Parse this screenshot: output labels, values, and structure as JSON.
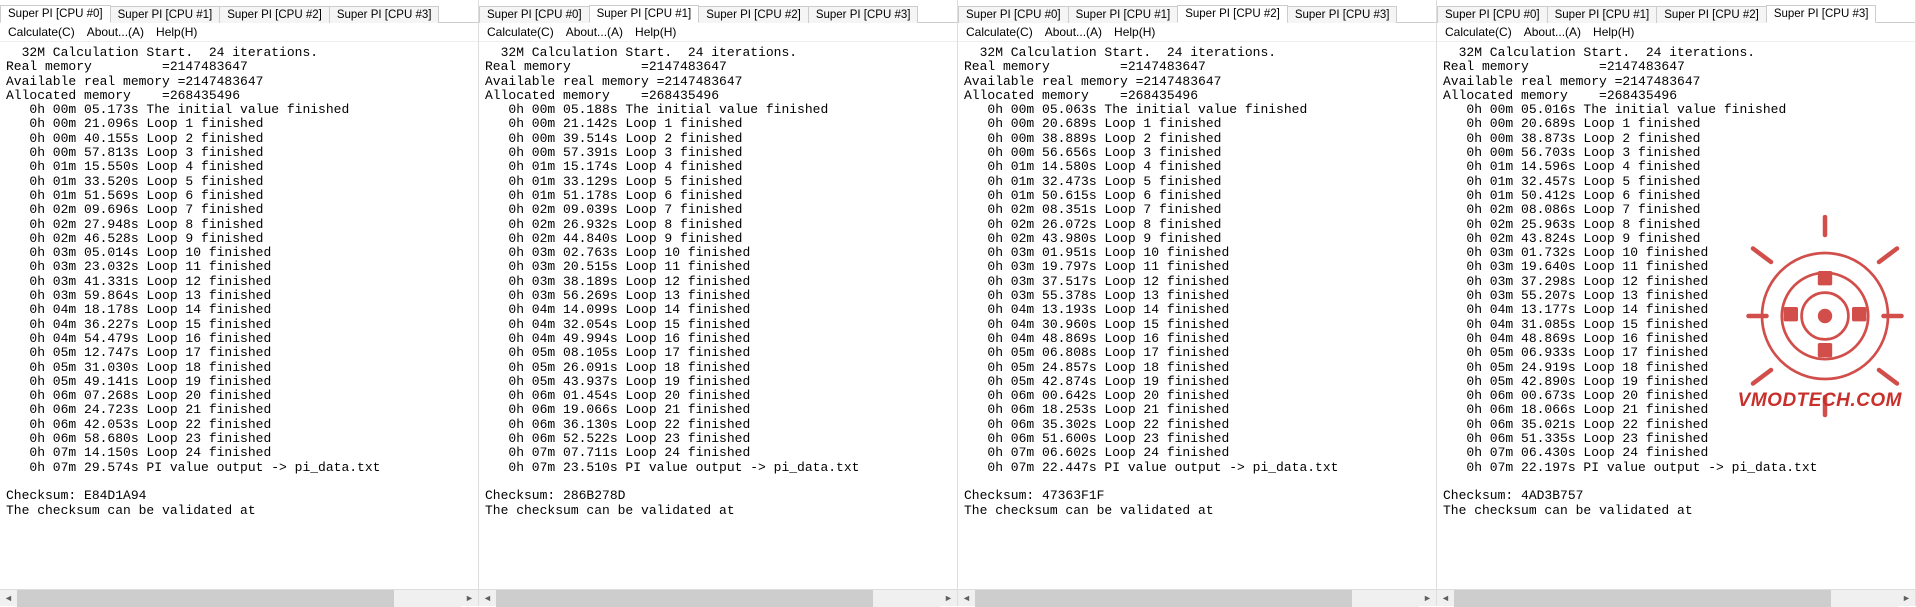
{
  "tabs": [
    "Super PI [CPU #0]",
    "Super PI [CPU #1]",
    "Super PI [CPU #2]",
    "Super PI [CPU #3]"
  ],
  "menu": {
    "calc": "Calculate(C)",
    "about": "About...(A)",
    "help": "Help(H)"
  },
  "header": {
    "start": "  32M Calculation Start.  24 iterations.",
    "real_mem": "Real memory         =2147483647",
    "avail_mem": "Available real memory =2147483647",
    "alloc_mem": "Allocated memory    =268435496"
  },
  "footer": {
    "checksum_label": "Checksum: ",
    "validate": "The checksum can be validated at"
  },
  "watermark_text": "VMODTECH.COM",
  "panes": [
    {
      "active": 0,
      "init": "   0h 00m 05.173s The initial value finished",
      "loops": [
        "   0h 00m 21.096s Loop 1 finished",
        "   0h 00m 40.155s Loop 2 finished",
        "   0h 00m 57.813s Loop 3 finished",
        "   0h 01m 15.550s Loop 4 finished",
        "   0h 01m 33.520s Loop 5 finished",
        "   0h 01m 51.569s Loop 6 finished",
        "   0h 02m 09.696s Loop 7 finished",
        "   0h 02m 27.948s Loop 8 finished",
        "   0h 02m 46.528s Loop 9 finished",
        "   0h 03m 05.014s Loop 10 finished",
        "   0h 03m 23.032s Loop 11 finished",
        "   0h 03m 41.331s Loop 12 finished",
        "   0h 03m 59.864s Loop 13 finished",
        "   0h 04m 18.178s Loop 14 finished",
        "   0h 04m 36.227s Loop 15 finished",
        "   0h 04m 54.479s Loop 16 finished",
        "   0h 05m 12.747s Loop 17 finished",
        "   0h 05m 31.030s Loop 18 finished",
        "   0h 05m 49.141s Loop 19 finished",
        "   0h 06m 07.268s Loop 20 finished",
        "   0h 06m 24.723s Loop 21 finished",
        "   0h 06m 42.053s Loop 22 finished",
        "   0h 06m 58.680s Loop 23 finished",
        "   0h 07m 14.150s Loop 24 finished"
      ],
      "output": "   0h 07m 29.574s PI value output -> pi_data.txt",
      "checksum": "E84D1A94"
    },
    {
      "active": 1,
      "init": "   0h 00m 05.188s The initial value finished",
      "loops": [
        "   0h 00m 21.142s Loop 1 finished",
        "   0h 00m 39.514s Loop 2 finished",
        "   0h 00m 57.391s Loop 3 finished",
        "   0h 01m 15.174s Loop 4 finished",
        "   0h 01m 33.129s Loop 5 finished",
        "   0h 01m 51.178s Loop 6 finished",
        "   0h 02m 09.039s Loop 7 finished",
        "   0h 02m 26.932s Loop 8 finished",
        "   0h 02m 44.840s Loop 9 finished",
        "   0h 03m 02.763s Loop 10 finished",
        "   0h 03m 20.515s Loop 11 finished",
        "   0h 03m 38.189s Loop 12 finished",
        "   0h 03m 56.269s Loop 13 finished",
        "   0h 04m 14.099s Loop 14 finished",
        "   0h 04m 32.054s Loop 15 finished",
        "   0h 04m 49.994s Loop 16 finished",
        "   0h 05m 08.105s Loop 17 finished",
        "   0h 05m 26.091s Loop 18 finished",
        "   0h 05m 43.937s Loop 19 finished",
        "   0h 06m 01.454s Loop 20 finished",
        "   0h 06m 19.066s Loop 21 finished",
        "   0h 06m 36.130s Loop 22 finished",
        "   0h 06m 52.522s Loop 23 finished",
        "   0h 07m 07.711s Loop 24 finished"
      ],
      "output": "   0h 07m 23.510s PI value output -> pi_data.txt",
      "checksum": "286B278D"
    },
    {
      "active": 2,
      "init": "   0h 00m 05.063s The initial value finished",
      "loops": [
        "   0h 00m 20.689s Loop 1 finished",
        "   0h 00m 38.889s Loop 2 finished",
        "   0h 00m 56.656s Loop 3 finished",
        "   0h 01m 14.580s Loop 4 finished",
        "   0h 01m 32.473s Loop 5 finished",
        "   0h 01m 50.615s Loop 6 finished",
        "   0h 02m 08.351s Loop 7 finished",
        "   0h 02m 26.072s Loop 8 finished",
        "   0h 02m 43.980s Loop 9 finished",
        "   0h 03m 01.951s Loop 10 finished",
        "   0h 03m 19.797s Loop 11 finished",
        "   0h 03m 37.517s Loop 12 finished",
        "   0h 03m 55.378s Loop 13 finished",
        "   0h 04m 13.193s Loop 14 finished",
        "   0h 04m 30.960s Loop 15 finished",
        "   0h 04m 48.869s Loop 16 finished",
        "   0h 05m 06.808s Loop 17 finished",
        "   0h 05m 24.857s Loop 18 finished",
        "   0h 05m 42.874s Loop 19 finished",
        "   0h 06m 00.642s Loop 20 finished",
        "   0h 06m 18.253s Loop 21 finished",
        "   0h 06m 35.302s Loop 22 finished",
        "   0h 06m 51.600s Loop 23 finished",
        "   0h 07m 06.602s Loop 24 finished"
      ],
      "output": "   0h 07m 22.447s PI value output -> pi_data.txt",
      "checksum": "47363F1F"
    },
    {
      "active": 3,
      "init": "   0h 00m 05.016s The initial value finished",
      "loops": [
        "   0h 00m 20.689s Loop 1 finished",
        "   0h 00m 38.873s Loop 2 finished",
        "   0h 00m 56.703s Loop 3 finished",
        "   0h 01m 14.596s Loop 4 finished",
        "   0h 01m 32.457s Loop 5 finished",
        "   0h 01m 50.412s Loop 6 finished",
        "   0h 02m 08.086s Loop 7 finished",
        "   0h 02m 25.963s Loop 8 finished",
        "   0h 02m 43.824s Loop 9 finished",
        "   0h 03m 01.732s Loop 10 finished",
        "   0h 03m 19.640s Loop 11 finished",
        "   0h 03m 37.298s Loop 12 finished",
        "   0h 03m 55.207s Loop 13 finished",
        "   0h 04m 13.177s Loop 14 finished",
        "   0h 04m 31.085s Loop 15 finished",
        "   0h 04m 48.869s Loop 16 finished",
        "   0h 05m 06.933s Loop 17 finished",
        "   0h 05m 24.919s Loop 18 finished",
        "   0h 05m 42.890s Loop 19 finished",
        "   0h 06m 00.673s Loop 20 finished",
        "   0h 06m 18.066s Loop 21 finished",
        "   0h 06m 35.021s Loop 22 finished",
        "   0h 06m 51.335s Loop 23 finished",
        "   0h 07m 06.430s Loop 24 finished"
      ],
      "output": "   0h 07m 22.197s PI value output -> pi_data.txt",
      "checksum": "4AD3B757"
    }
  ]
}
